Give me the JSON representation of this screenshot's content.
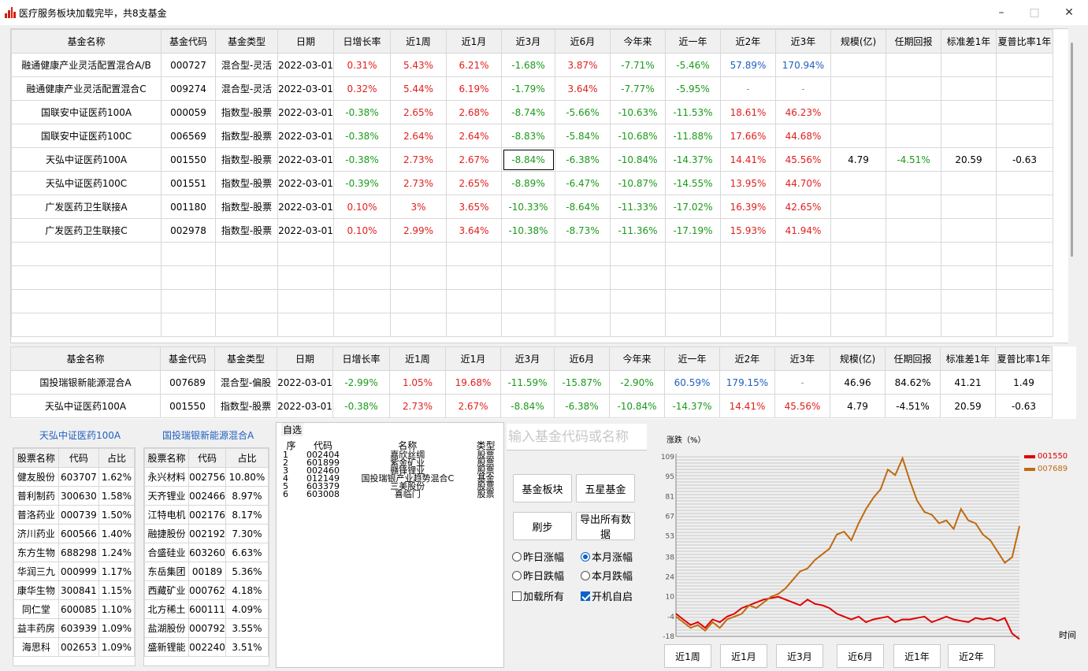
{
  "window": {
    "title": "医疗服务板块加载完毕，共8支基金",
    "minimize": "–",
    "maximize": "□",
    "close": "✕"
  },
  "columns": [
    "基金名称",
    "基金代码",
    "基金类型",
    "日期",
    "日增长率",
    "近1周",
    "近1月",
    "近3月",
    "近6月",
    "今年来",
    "近一年",
    "近2年",
    "近3年",
    "规模(亿)",
    "任期回报",
    "标准差1年",
    "夏普比率1年"
  ],
  "funds": [
    [
      "融通健康产业灵活配置混合A/B",
      "000727",
      "混合型-灵活",
      "2022-03-01",
      "0.31%",
      "5.43%",
      "6.21%",
      "-1.68%",
      "3.87%",
      "-7.71%",
      "-5.46%",
      "57.89%",
      "170.94%",
      "",
      "",
      "",
      ""
    ],
    [
      "融通健康产业灵活配置混合C",
      "009274",
      "混合型-灵活",
      "2022-03-01",
      "0.32%",
      "5.44%",
      "6.19%",
      "-1.79%",
      "3.64%",
      "-7.77%",
      "-5.95%",
      "-",
      "-",
      "",
      "",
      "",
      ""
    ],
    [
      "国联安中证医药100A",
      "000059",
      "指数型-股票",
      "2022-03-01",
      "-0.38%",
      "2.65%",
      "2.68%",
      "-8.74%",
      "-5.66%",
      "-10.63%",
      "-11.53%",
      "18.61%",
      "46.23%",
      "",
      "",
      "",
      ""
    ],
    [
      "国联安中证医药100C",
      "006569",
      "指数型-股票",
      "2022-03-01",
      "-0.38%",
      "2.64%",
      "2.64%",
      "-8.83%",
      "-5.84%",
      "-10.68%",
      "-11.88%",
      "17.66%",
      "44.68%",
      "",
      "",
      "",
      ""
    ],
    [
      "天弘中证医药100A",
      "001550",
      "指数型-股票",
      "2022-03-01",
      "-0.38%",
      "2.73%",
      "2.67%",
      "-8.84%",
      "-6.38%",
      "-10.84%",
      "-14.37%",
      "14.41%",
      "45.56%",
      "4.79",
      "-4.51%",
      "20.59",
      "-0.63"
    ],
    [
      "天弘中证医药100C",
      "001551",
      "指数型-股票",
      "2022-03-01",
      "-0.39%",
      "2.73%",
      "2.65%",
      "-8.89%",
      "-6.47%",
      "-10.87%",
      "-14.55%",
      "13.95%",
      "44.70%",
      "",
      "",
      "",
      ""
    ],
    [
      "广发医药卫生联接A",
      "001180",
      "指数型-股票",
      "2022-03-01",
      "0.10%",
      "3%",
      "3.65%",
      "-10.33%",
      "-8.64%",
      "-11.33%",
      "-17.02%",
      "16.39%",
      "42.65%",
      "",
      "",
      "",
      ""
    ],
    [
      "广发医药卫生联接C",
      "002978",
      "指数型-股票",
      "2022-03-01",
      "0.10%",
      "2.99%",
      "3.64%",
      "-10.38%",
      "-8.73%",
      "-11.36%",
      "-17.19%",
      "15.93%",
      "41.94%",
      "",
      "",
      "",
      ""
    ]
  ],
  "compare": [
    [
      "国投瑞银新能源混合A",
      "007689",
      "混合型-偏股",
      "2022-03-01",
      "-2.99%",
      "1.05%",
      "19.68%",
      "-11.59%",
      "-15.87%",
      "-2.90%",
      "60.59%",
      "179.15%",
      "-",
      "46.96",
      "84.62%",
      "41.21",
      "1.49"
    ],
    [
      "天弘中证医药100A",
      "001550",
      "指数型-股票",
      "2022-03-01",
      "-0.38%",
      "2.73%",
      "2.67%",
      "-8.84%",
      "-6.38%",
      "-10.84%",
      "-14.37%",
      "14.41%",
      "45.56%",
      "4.79",
      "-4.51%",
      "20.59",
      "-0.63"
    ]
  ],
  "holdings": {
    "cols": [
      "股票名称",
      "代码",
      "占比"
    ],
    "left": {
      "title": "天弘中证医药100A",
      "rows": [
        [
          "健友股份",
          "603707",
          "1.62%"
        ],
        [
          "普利制药",
          "300630",
          "1.58%"
        ],
        [
          "普洛药业",
          "000739",
          "1.50%"
        ],
        [
          "济川药业",
          "600566",
          "1.40%"
        ],
        [
          "东方生物",
          "688298",
          "1.24%"
        ],
        [
          "华润三九",
          "000999",
          "1.17%"
        ],
        [
          "康华生物",
          "300841",
          "1.15%"
        ],
        [
          "同仁堂",
          "600085",
          "1.10%"
        ],
        [
          "益丰药房",
          "603939",
          "1.09%"
        ],
        [
          "海思科",
          "002653",
          "1.09%"
        ]
      ]
    },
    "right": {
      "title": "国投瑞银新能源混合A",
      "rows": [
        [
          "永兴材料",
          "002756",
          "10.80%"
        ],
        [
          "天齐锂业",
          "002466",
          "8.97%"
        ],
        [
          "江特电机",
          "002176",
          "8.17%"
        ],
        [
          "融捷股份",
          "002192",
          "7.30%"
        ],
        [
          "合盛硅业",
          "603260",
          "6.63%"
        ],
        [
          "东岳集团",
          "00189",
          "5.36%"
        ],
        [
          "西藏矿业",
          "000762",
          "4.18%"
        ],
        [
          "北方稀土",
          "600111",
          "4.09%"
        ],
        [
          "盐湖股份",
          "000792",
          "3.55%"
        ],
        [
          "盛新锂能",
          "002240",
          "3.51%"
        ]
      ]
    }
  },
  "watchlist": {
    "label": "自选",
    "cols": [
      "序",
      "代码",
      "名称",
      "类型"
    ],
    "rows": [
      [
        "1",
        "002404",
        "嘉欣丝绸",
        "股票"
      ],
      [
        "2",
        "601899",
        "紫金矿业",
        "股票"
      ],
      [
        "3",
        "002460",
        "赣锋锂业",
        "股票"
      ],
      [
        "4",
        "012149",
        "国投瑞银产业趋势混合C",
        "基金"
      ],
      [
        "5",
        "603379",
        "三美股份",
        "股票"
      ],
      [
        "6",
        "603008",
        "喜临门",
        "股票"
      ]
    ]
  },
  "controls": {
    "search_placeholder": "输入基金代码或名称",
    "btn_sector": "基金板块",
    "btn_five_star": "五星基金",
    "btn_refresh": "刷步",
    "btn_export": "导出所有数据",
    "opt_yday_up": "昨日涨幅",
    "opt_month_up": "本月涨幅",
    "opt_yday_down": "昨日跌幅",
    "opt_month_down": "本月跌幅",
    "opt_load_all": "加载所有",
    "opt_autostart": "开机自启"
  },
  "chart_data": {
    "type": "line",
    "ylabel": "涨跌（%）",
    "xlabel": "时间",
    "yticks": [
      109,
      95,
      81,
      67,
      53,
      38,
      24,
      10,
      -4,
      -18
    ],
    "ylim": [
      -18,
      109
    ],
    "series": [
      {
        "name": "001550",
        "color": "#e00000",
        "values": [
          -2,
          -6,
          -10,
          -8,
          -12,
          -6,
          -8,
          -4,
          -2,
          2,
          4,
          6,
          8,
          9,
          10,
          8,
          6,
          4,
          8,
          5,
          4,
          2,
          -2,
          -4,
          -6,
          -4,
          -8,
          -6,
          -5,
          -4,
          -8,
          -6,
          -6,
          -5,
          -4,
          -8,
          -6,
          -4,
          -6,
          -7,
          -8,
          -5,
          -6,
          -5,
          -7,
          -5,
          -16,
          -20
        ]
      },
      {
        "name": "007689",
        "color": "#c06a10",
        "values": [
          -4,
          -8,
          -12,
          -10,
          -14,
          -8,
          -12,
          -6,
          -4,
          -2,
          4,
          2,
          6,
          10,
          12,
          16,
          22,
          28,
          30,
          36,
          40,
          44,
          54,
          56,
          50,
          62,
          72,
          80,
          86,
          100,
          96,
          108,
          92,
          78,
          70,
          68,
          62,
          64,
          58,
          72,
          64,
          62,
          54,
          50,
          42,
          34,
          38,
          60
        ]
      }
    ],
    "ranges": [
      "近1周",
      "近1月",
      "近3月",
      "近6月",
      "近1年",
      "近2年"
    ]
  },
  "colors": {
    "up": "#e0201e",
    "down": "#1a9a1a",
    "blue": "#2060c0",
    "accent": "#0a64c8"
  }
}
